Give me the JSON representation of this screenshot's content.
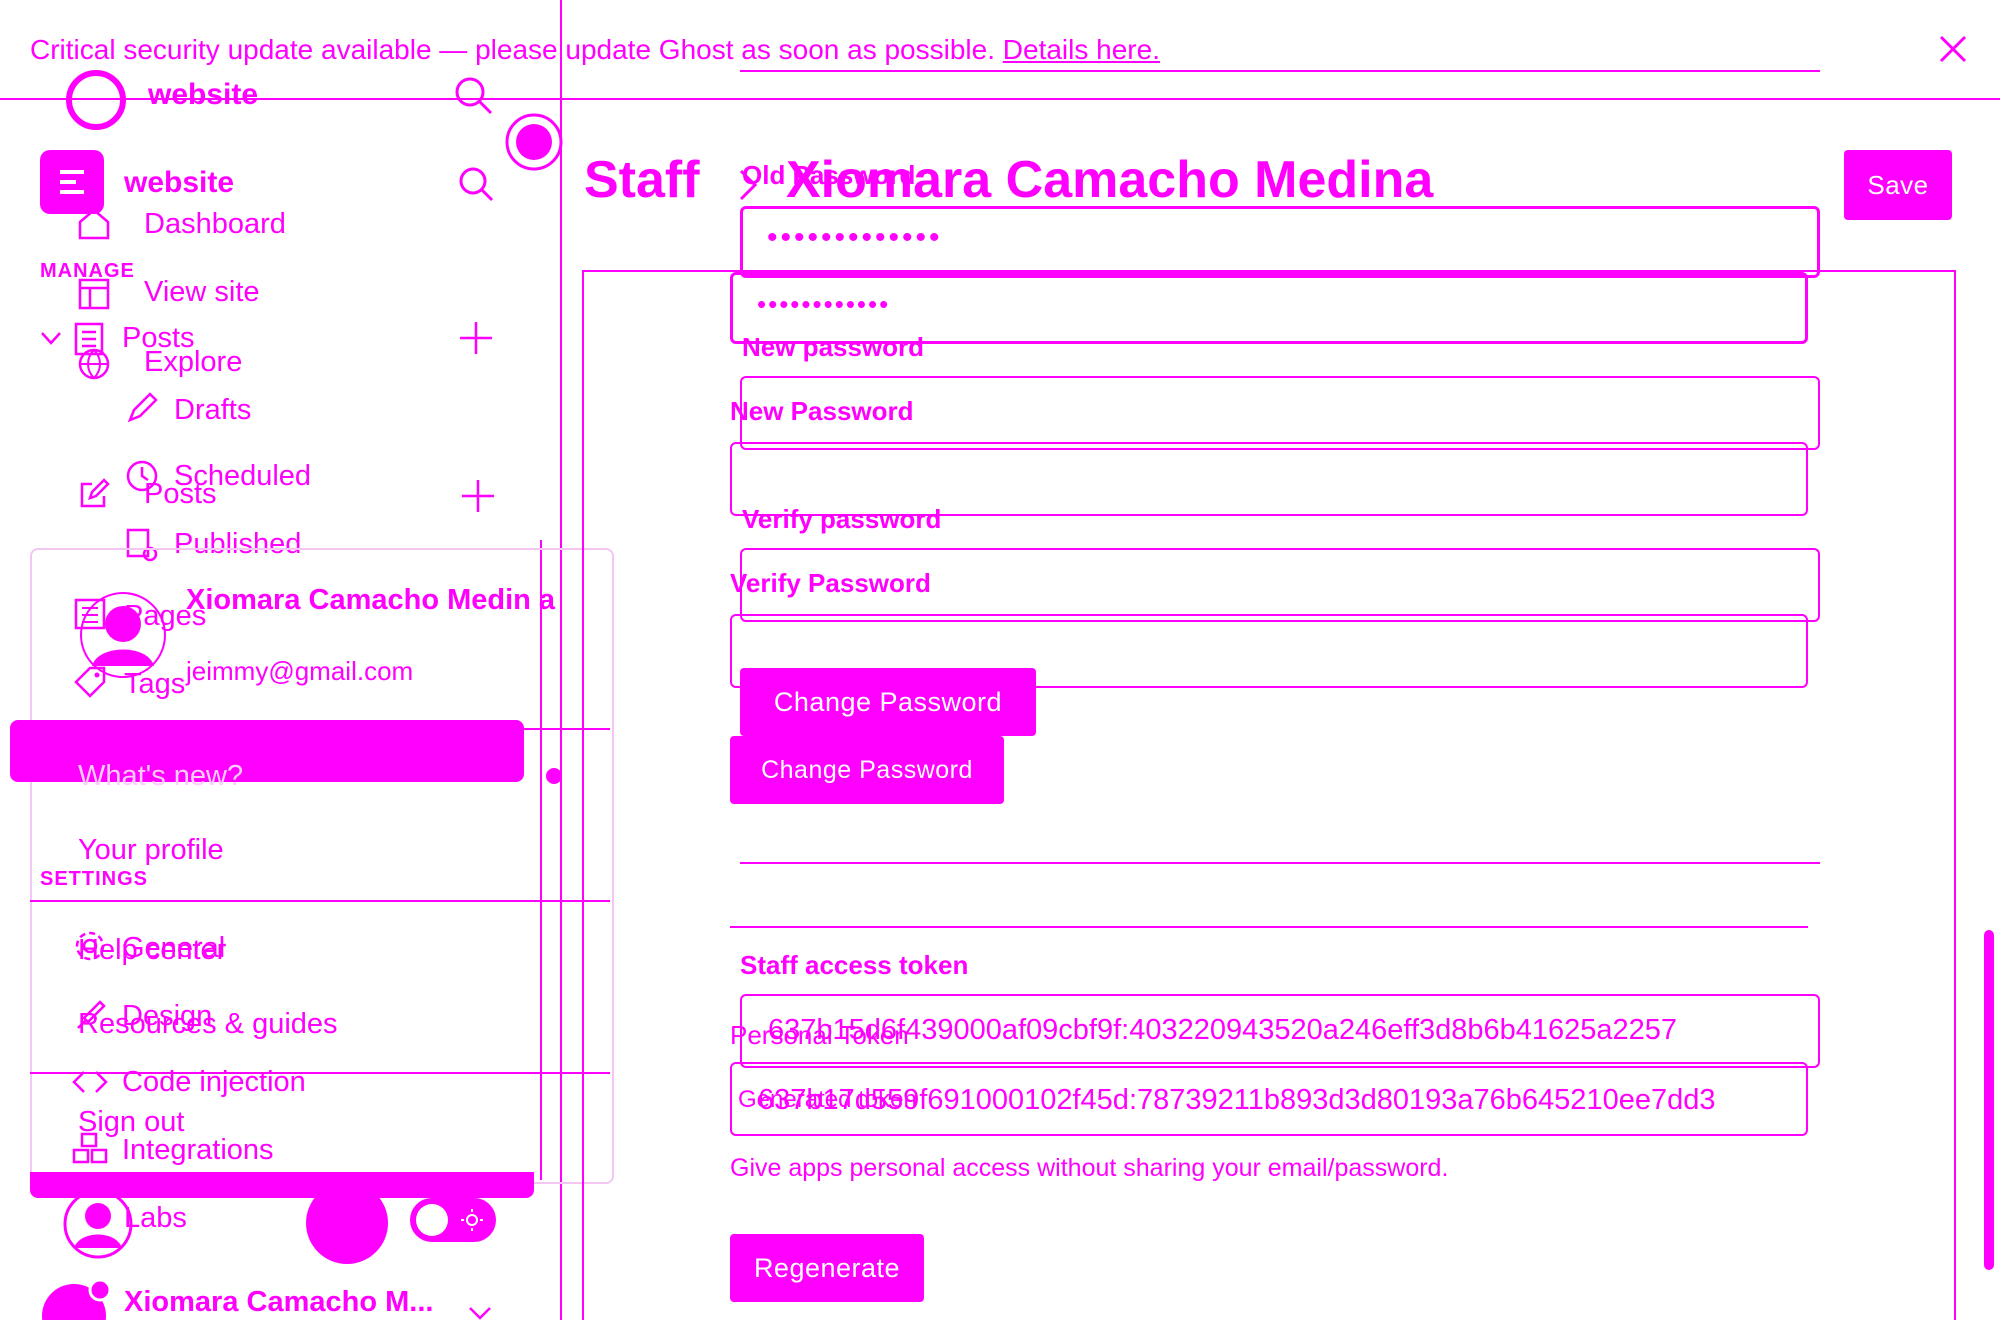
{
  "banner": {
    "text": "Critical security update available — please update Ghost as soon as possible.",
    "link": "Details here."
  },
  "site": {
    "name": "website"
  },
  "sidebar": {
    "nav_a": [
      {
        "label": "Dashboard"
      },
      {
        "label": "View site"
      },
      {
        "label": "Explore"
      },
      {
        "label": "Posts"
      }
    ],
    "manage_heading": "MANAGE",
    "posts_label": "Posts",
    "posts_sub": [
      {
        "label": "Drafts"
      },
      {
        "label": "Scheduled"
      },
      {
        "label": "Published"
      }
    ],
    "pages_label": "Pages",
    "tags_label": "Tags",
    "settings_heading": "SETTINGS",
    "settings": [
      {
        "label": "General"
      },
      {
        "label": "Design"
      },
      {
        "label": "Code injection"
      },
      {
        "label": "Integrations"
      },
      {
        "label": "Labs"
      }
    ],
    "footer_user": "Xiomara Camacho M..."
  },
  "dropdown": {
    "name": "Xiomara Camacho Medin a",
    "email": "jeimmy@gmail.com",
    "items": [
      "What's new?",
      "Your profile",
      "Help center",
      "Resources & guides",
      "Sign out"
    ]
  },
  "header": {
    "breadcrumb": "Staff",
    "title": "Xiomara Camacho Medina",
    "save": "Save"
  },
  "form": {
    "old_password_label": "Old Password",
    "old_password_value": "•••••••••••••",
    "old_password_value_b": "••••••••••••",
    "new_password_label": "New password",
    "new_password_label_b": "New Password",
    "verify_label": "Verify password",
    "verify_label_b": "Verify Password",
    "change_button": "Change Password",
    "token_heading": "Staff access token",
    "token_label": "Personal Token",
    "token_value": "637b15d6f439000af09cbf9f:403220943520a246eff3d8b6b41625a2257",
    "token_value_b": "637b17d559f691000102f45d:78739211b893d3d80193a76b645210ee7dd3",
    "token_label_b": "Generated token",
    "token_hint": "Give apps personal access without sharing your email/password.",
    "regenerate": "Regenerate"
  }
}
